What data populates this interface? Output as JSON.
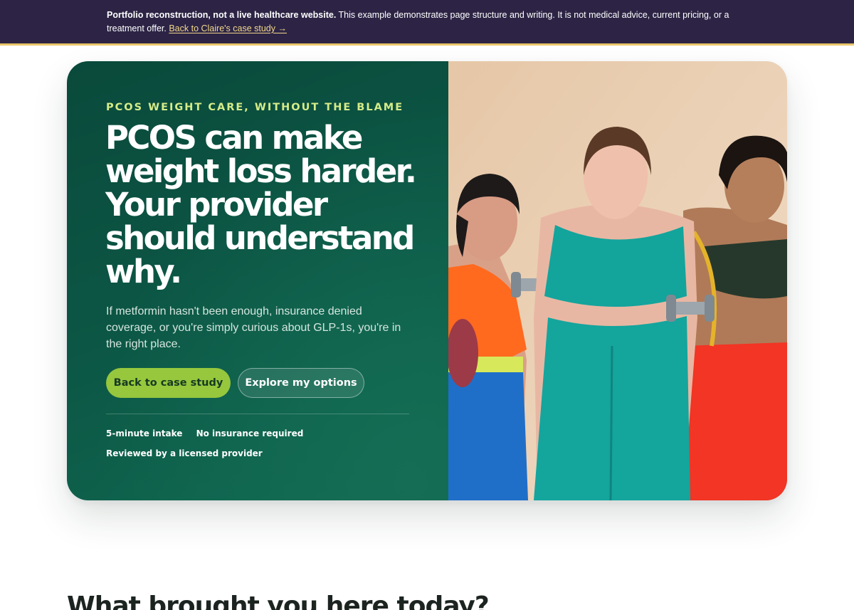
{
  "banner": {
    "strong_text": "Portfolio reconstruction, not a live healthcare website.",
    "body_text": "This example demonstrates page structure and writing. It is not medical advice, current pricing, or a treatment offer.",
    "link_label": "Back to Claire's case study →"
  },
  "hero": {
    "eyebrow": "PCOS WEIGHT CARE, WITHOUT THE BLAME",
    "headline": "PCOS can make weight loss harder. Your provider should understand why.",
    "lede": "If metformin hasn't been enough, insurance denied coverage, or you're simply curious about GLP-1s, you're in the right place.",
    "primary_button": "Back to case study",
    "secondary_button": "Explore my options",
    "badges": [
      "5-minute intake",
      "No insurance required",
      "Reviewed by a licensed provider"
    ],
    "photo_icon": "fitness-photo"
  },
  "next_section": {
    "title": "What brought you here today?"
  },
  "colors": {
    "banner_bg": "#2d2445",
    "banner_accent": "#e9c66a",
    "hero_green": "#0c5645",
    "eyebrow_lime": "#d6ec88",
    "button_lime": "#96c73d"
  }
}
